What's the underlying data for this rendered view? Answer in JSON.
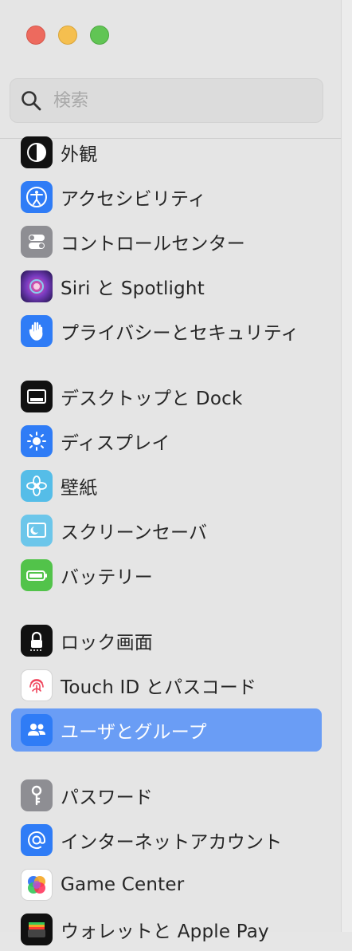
{
  "window": {
    "controls": [
      "close",
      "minimize",
      "zoom"
    ]
  },
  "search": {
    "placeholder": "検索",
    "value": ""
  },
  "sidebar": {
    "items": [
      {
        "label": "外観",
        "icon": "appearance-icon",
        "color": "#111111"
      },
      {
        "label": "アクセシビリティ",
        "icon": "accessibility-icon",
        "color": "#2f7cf6"
      },
      {
        "label": "コントロールセンター",
        "icon": "control-center-icon",
        "color": "#8e8e93"
      },
      {
        "label": "Siri と Spotlight",
        "icon": "siri-icon",
        "color": "#5a2d8a"
      },
      {
        "label": "プライバシーとセキュリティ",
        "icon": "hand-icon",
        "color": "#2f7cf6"
      },
      {
        "label": "デスクトップと Dock",
        "icon": "dock-icon",
        "color": "#111111"
      },
      {
        "label": "ディスプレイ",
        "icon": "display-icon",
        "color": "#2f7cf6"
      },
      {
        "label": "壁紙",
        "icon": "wallpaper-icon",
        "color": "#55bde8"
      },
      {
        "label": "スクリーンセーバ",
        "icon": "screensaver-icon",
        "color": "#6cc6ea"
      },
      {
        "label": "バッテリー",
        "icon": "battery-icon",
        "color": "#52c34a"
      },
      {
        "label": "ロック画面",
        "icon": "lock-icon",
        "color": "#111111"
      },
      {
        "label": "Touch ID とパスコード",
        "icon": "fingerprint-icon",
        "color": "#ffffff"
      },
      {
        "label": "ユーザとグループ",
        "icon": "users-icon",
        "color": "#2f7cf6",
        "selected": true
      },
      {
        "label": "パスワード",
        "icon": "key-icon",
        "color": "#8e8e93"
      },
      {
        "label": "インターネットアカウント",
        "icon": "at-icon",
        "color": "#2f7cf6"
      },
      {
        "label": "Game Center",
        "icon": "game-center-icon",
        "color": "#ffffff"
      },
      {
        "label": "ウォレットと Apple Pay",
        "icon": "wallet-icon",
        "color": "#111111"
      }
    ]
  },
  "colors": {
    "selection": "#6a9df5",
    "sidebar_bg": "#e5e5e5"
  }
}
